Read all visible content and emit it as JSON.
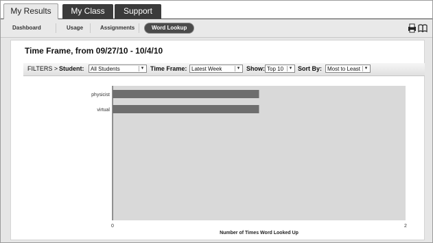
{
  "tabs": [
    {
      "label": "My Results",
      "active": true
    },
    {
      "label": "My Class",
      "active": false
    },
    {
      "label": "Support",
      "active": false
    }
  ],
  "subnav": {
    "items": [
      "Dashboard",
      "Usage",
      "Assignments",
      "Word Lookup"
    ],
    "active": "Word Lookup",
    "icons": [
      "printer-icon",
      "book-icon"
    ]
  },
  "panel": {
    "heading": "Time Frame, from 09/27/10 - 10/4/10"
  },
  "filters": {
    "prefix": "FILTERS >",
    "student_label": "Student:",
    "student_value": "All Students",
    "timeframe_label": "Time Frame:",
    "timeframe_value": "Latest Week",
    "show_label": "Show:",
    "show_value": "Top 10",
    "sortby_label": "Sort By:",
    "sortby_value": "Most to Least",
    "dropdown_glyph": "▾"
  },
  "chart_data": {
    "type": "bar",
    "orientation": "horizontal",
    "categories": [
      "physicist",
      "virtual"
    ],
    "values": [
      1,
      1
    ],
    "xlabel": "Number of Times Word Looked Up",
    "xlim": [
      0,
      2
    ],
    "x_ticks": [
      "0",
      "2"
    ],
    "bar_color": "#6e6e6e",
    "plot_bg": "#d9d9d9"
  }
}
